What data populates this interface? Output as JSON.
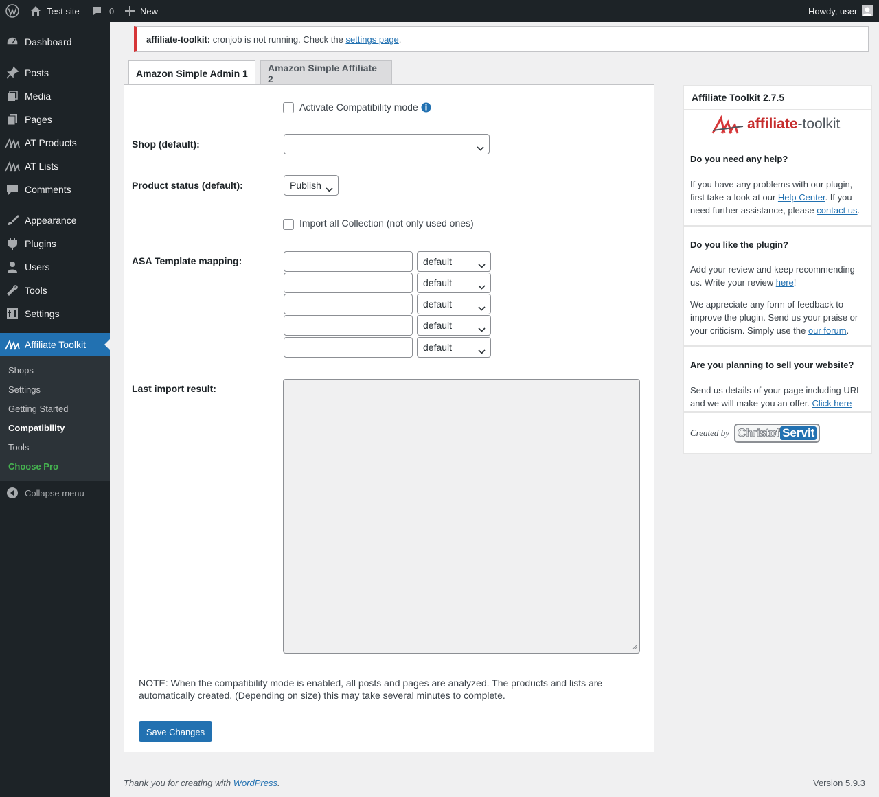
{
  "adminbar": {
    "site_name": "Test site",
    "comments_count": "0",
    "new_label": "New",
    "greeting": "Howdy, user"
  },
  "sidebar": {
    "items": [
      {
        "label": "Dashboard",
        "icon": "dashboard-icon"
      },
      {
        "label": "Posts",
        "icon": "pin-icon"
      },
      {
        "label": "Media",
        "icon": "media-icon"
      },
      {
        "label": "Pages",
        "icon": "pages-icon"
      },
      {
        "label": "AT Products",
        "icon": "affiliate-toolkit-icon"
      },
      {
        "label": "AT Lists",
        "icon": "affiliate-toolkit-icon"
      },
      {
        "label": "Comments",
        "icon": "comment-icon"
      },
      {
        "label": "Appearance",
        "icon": "brush-icon"
      },
      {
        "label": "Plugins",
        "icon": "plugin-icon"
      },
      {
        "label": "Users",
        "icon": "user-icon"
      },
      {
        "label": "Tools",
        "icon": "wrench-icon"
      },
      {
        "label": "Settings",
        "icon": "settings-icon"
      },
      {
        "label": "Affiliate Toolkit",
        "icon": "affiliate-toolkit-icon"
      }
    ],
    "submenu": [
      "Shops",
      "Settings",
      "Getting Started",
      "Compatibility",
      "Tools",
      "Choose Pro"
    ],
    "collapse_label": "Collapse menu"
  },
  "notice": {
    "prefix": "affiliate-toolkit:",
    "text": " cronjob is not running. Check the ",
    "link": "settings page",
    "suffix": "."
  },
  "tabs": [
    {
      "label": "Amazon Simple Admin 1",
      "active": true
    },
    {
      "label": "Amazon Simple Affiliate 2",
      "active": false
    }
  ],
  "form": {
    "compat_mode_label": "Activate Compatibility mode",
    "compat_mode_checked": false,
    "shop_label": "Shop (default):",
    "shop_value": "",
    "product_status_label": "Product status (default):",
    "product_status_value": "Publish",
    "import_all_label": "Import all Collection (not only used ones)",
    "import_all_checked": false,
    "template_mapping_label": "ASA Template mapping:",
    "template_mapping": [
      {
        "input": "",
        "select": "default"
      },
      {
        "input": "",
        "select": "default"
      },
      {
        "input": "",
        "select": "default"
      },
      {
        "input": "",
        "select": "default"
      },
      {
        "input": "",
        "select": "default"
      }
    ],
    "last_import_label": "Last import result:",
    "last_import_value": "",
    "note": "NOTE: When the compatibility mode is enabled, all posts and pages are analyzed. The products and lists are automatically created. (Depending on size) this may take several minutes to complete.",
    "save_label": "Save Changes"
  },
  "sidebox": {
    "title": "Affiliate Toolkit 2.7.5",
    "logo_text_a": "affiliate",
    "logo_text_b": "-toolkit",
    "help_heading": "Do you need any help?",
    "help_text_1": "If you have any problems with our plugin, first take a look at our ",
    "help_link_1": "Help Center",
    "help_text_2": ". If you need further assistance, please ",
    "help_link_2": "contact us",
    "help_text_3": ".",
    "like_heading": "Do you like the plugin?",
    "like_text_1": "Add your review and keep recommending us. Write your review ",
    "like_link_1": "here",
    "like_text_2": "!",
    "feedback_text": "We appreciate any form of feedback to improve the plugin. Send us your praise or your criticism. Simply use the ",
    "feedback_link": "our forum",
    "feedback_end": ".",
    "sell_heading": "Are you planning to sell your website?",
    "sell_text": "Send us details of your page including URL and we will make you an offer. ",
    "sell_link": "Click here",
    "created_by": "Created by",
    "brand_a": "Christof",
    "brand_b": "Servit"
  },
  "footer": {
    "thanks_text": "Thank you for creating with ",
    "thanks_link": "WordPress",
    "thanks_end": ".",
    "version": "Version 5.9.3"
  }
}
